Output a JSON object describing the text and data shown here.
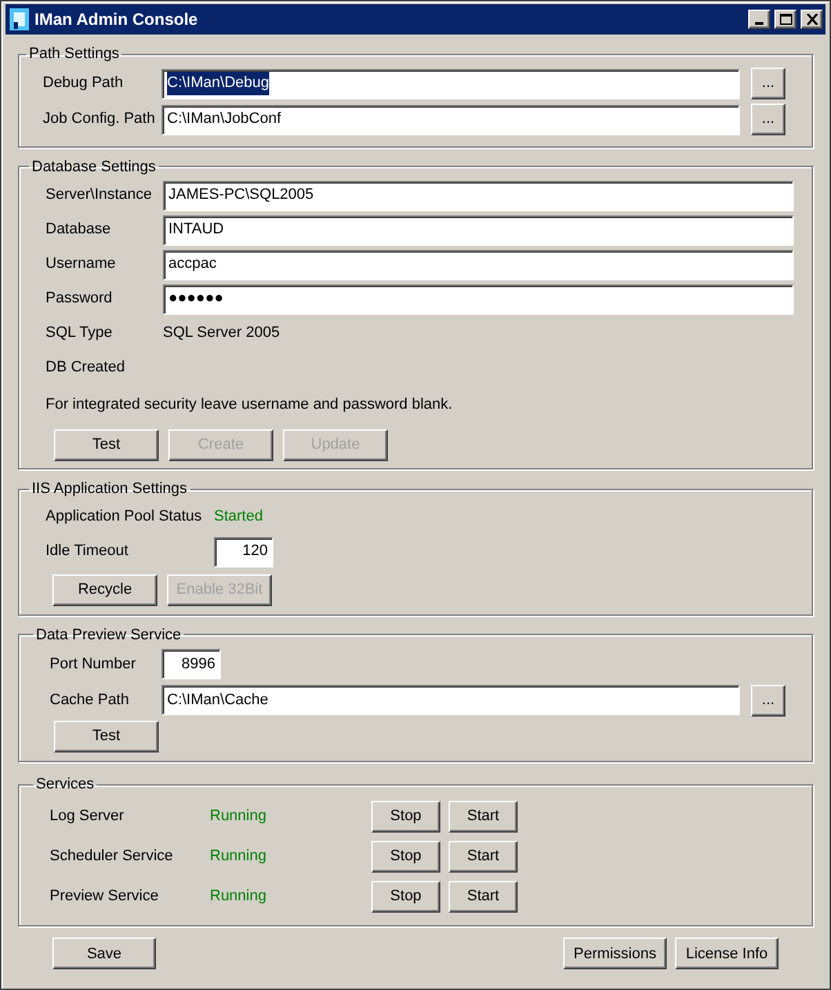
{
  "window": {
    "title": "IMan Admin Console"
  },
  "path_settings": {
    "title": "Path Settings",
    "rows": [
      {
        "label": "Debug Path",
        "value": "C:\\IMan\\Debug",
        "highlighted": true,
        "browse": "..."
      },
      {
        "label": "Job Config. Path",
        "value": "C:\\IMan\\JobConf",
        "highlighted": false,
        "browse": "..."
      }
    ]
  },
  "database_settings": {
    "title": "Database Settings",
    "fields": [
      {
        "label": "Server\\Instance",
        "value": "JAMES-PC\\SQL2005",
        "kind": "text"
      },
      {
        "label": "Database",
        "value": "INTAUD",
        "kind": "text"
      },
      {
        "label": "Username",
        "value": "accpac",
        "kind": "text"
      },
      {
        "label": "Password",
        "value": "●●●●●●",
        "kind": "password"
      },
      {
        "label": "SQL Type",
        "value": "SQL Server 2005",
        "kind": "static"
      },
      {
        "label": "DB Created",
        "kind": "static"
      }
    ],
    "note": "For integrated security leave username and password blank.",
    "buttons": [
      {
        "label": "Test",
        "disabled": false
      },
      {
        "label": "Create",
        "disabled": true
      },
      {
        "label": "Update",
        "disabled": true
      }
    ]
  },
  "iis_settings": {
    "title": "IIS Application Settings",
    "pool_status_label": "Application Pool Status",
    "pool_status": "Started",
    "idle_timeout_label": "Idle Timeout",
    "idle_timeout": "120",
    "buttons": [
      {
        "label": "Recycle",
        "disabled": false
      },
      {
        "label": "Enable 32Bit",
        "disabled": true
      }
    ]
  },
  "data_preview_service": {
    "title": "Data Preview Service",
    "port_label": "Port Number",
    "port": "8996",
    "cache_label": "Cache Path",
    "cache_path": "C:\\IMan\\Cache",
    "browse": "...",
    "buttons": [
      {
        "label": "Test",
        "disabled": false
      }
    ]
  },
  "services": {
    "title": "Services",
    "rows": [
      {
        "name": "Log Server",
        "status": "Running",
        "buttons": [
          "Stop",
          "Start"
        ]
      },
      {
        "name": "Scheduler Service",
        "status": "Running",
        "buttons": [
          "Stop",
          "Start"
        ]
      },
      {
        "name": "Preview Service",
        "status": "Running",
        "buttons": [
          "Stop",
          "Start"
        ]
      }
    ]
  },
  "footer_buttons": [
    {
      "label": "Save"
    },
    {
      "label": "Permissions"
    },
    {
      "label": "License Info"
    }
  ]
}
